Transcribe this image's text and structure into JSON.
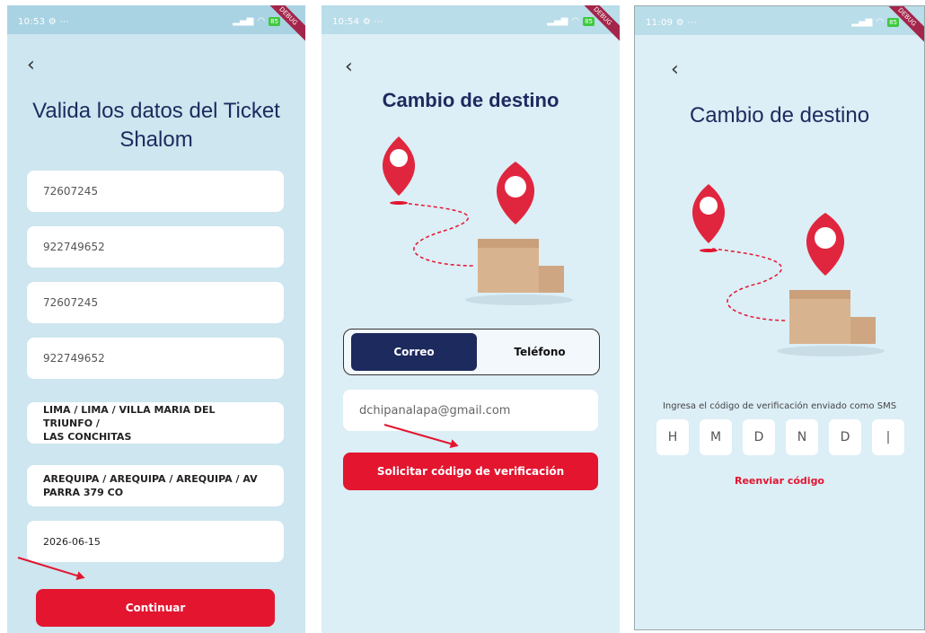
{
  "screen1": {
    "status": {
      "time": "10:53 ⚙ ⋯",
      "battery": "85",
      "ribbon": "DEBUG"
    },
    "title_line1": "Valida los datos del Ticket",
    "title_line2": "Shalom",
    "fields": [
      "72607245",
      "922749652",
      "72607245",
      "922749652"
    ],
    "origin_line1": "LIMA / LIMA / VILLA MARIA DEL TRIUNFO /",
    "origin_line2": "LAS CONCHITAS",
    "destination_line1": "AREQUIPA / AREQUIPA / AREQUIPA / AV",
    "destination_line2": "PARRA 379 CO",
    "date": "2026-06-15",
    "continue_label": "Continuar"
  },
  "screen2": {
    "status": {
      "time": "10:54 ⚙ ⋯",
      "battery": "85",
      "ribbon": "DEBUG"
    },
    "title": "Cambio de destino",
    "toggle": {
      "email": "Correo",
      "phone": "Teléfono",
      "selected": "Correo"
    },
    "email_value": "dchipanalapa@gmail.com",
    "request_code_label": "Solicitar código de verificación"
  },
  "screen3": {
    "status": {
      "time": "11:09 ⚙ ⋯",
      "battery": "85",
      "ribbon": "DEBUG"
    },
    "title": "Cambio de destino",
    "hint": "Ingresa el código de verificación enviado como SMS",
    "code": [
      "H",
      "M",
      "D",
      "N",
      "D",
      "|"
    ],
    "resend_label": "Reenviar código"
  },
  "colors": {
    "primary_red": "#e3152f",
    "navy": "#1d2a5e",
    "bg_light_blue": "#dceef6"
  },
  "icons": {
    "back": "back-chevron-icon",
    "signal": "signal-icon",
    "wifi": "wifi-icon",
    "battery": "battery-icon"
  }
}
